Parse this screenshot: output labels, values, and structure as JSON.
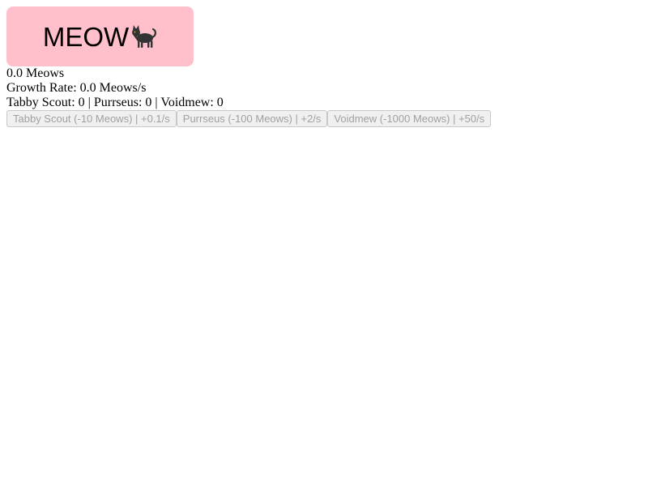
{
  "meow_button": {
    "label": "MEOW",
    "icon": "cat-icon",
    "color": "#ffc0cb"
  },
  "stats": {
    "meows": "0.0 Meows",
    "growth_rate": "Growth Rate: 0.0 Meows/s",
    "counts": "Tabby Scout: 0 | Purrseus: 0 | Voidmew: 0"
  },
  "upgrades": [
    {
      "label": "Tabby Scout (-10 Meows) | +0.1/s",
      "disabled": true
    },
    {
      "label": "Purrseus (-100 Meows) | +2/s",
      "disabled": true
    },
    {
      "label": "Voidmew (-1000 Meows) | +50/s",
      "disabled": true
    }
  ]
}
